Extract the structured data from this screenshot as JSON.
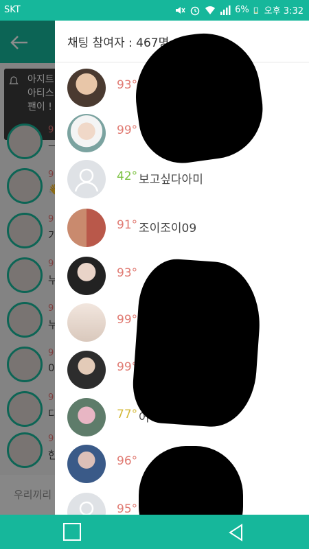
{
  "status_bar": {
    "carrier": "SKT",
    "battery": "6%",
    "time": "오후 3:32"
  },
  "background": {
    "notice_lines": [
      "아지트",
      "아티스",
      "팬이 !"
    ],
    "rows": [
      {
        "temp": "9",
        "msg": "ㅡ"
      },
      {
        "temp": "9",
        "msg": "👋"
      },
      {
        "temp": "9",
        "msg": "가"
      },
      {
        "temp": "9",
        "msg": "누"
      },
      {
        "temp": "9",
        "msg": "누"
      },
      {
        "temp": "9",
        "msg": "0"
      },
      {
        "temp": "9",
        "msg": "다"
      },
      {
        "temp": "9",
        "msg": "한"
      }
    ],
    "input_text": "우리끼리"
  },
  "panel": {
    "title": "채팅 참여자 : 467명",
    "participants": [
      {
        "temp": "93°",
        "name": "",
        "temp_color": "#e07a72"
      },
      {
        "temp": "99°",
        "name": "",
        "temp_color": "#e07a72"
      },
      {
        "temp": "42°",
        "name": "보고싶다아미",
        "temp_color": "#7cc242"
      },
      {
        "temp": "91°",
        "name": "조이조이09",
        "temp_color": "#e07a72"
      },
      {
        "temp": "93°",
        "name": "",
        "temp_color": "#e07a72"
      },
      {
        "temp": "99°",
        "name": "",
        "temp_color": "#e07a72"
      },
      {
        "temp": "99°",
        "name": "",
        "temp_color": "#e07a72"
      },
      {
        "temp": "77°",
        "name": "어디에서왔는지민",
        "temp_color": "#d4b93a"
      },
      {
        "temp": "96°",
        "name": "",
        "temp_color": "#e07a72"
      },
      {
        "temp": "95°",
        "name": "",
        "temp_color": "#e07a72"
      }
    ]
  },
  "colors": {
    "accent": "#16b79b"
  }
}
